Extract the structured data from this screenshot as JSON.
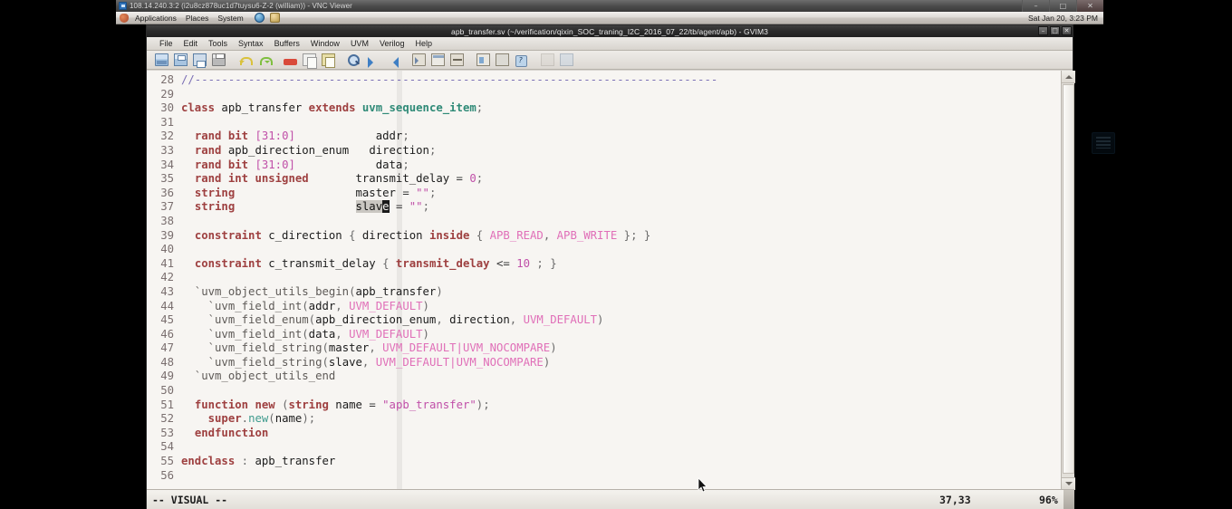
{
  "vnc": {
    "title": "108.14.240.3:2 (i2u8cz878uc1d7tuysu6-Z-2 (william)) - VNC Viewer",
    "icon": "vnc-icon",
    "buttons": [
      {
        "name": "minimize",
        "glyph": "–"
      },
      {
        "name": "maximize",
        "glyph": "□"
      },
      {
        "name": "close",
        "glyph": "✕"
      }
    ]
  },
  "gnome_panel": {
    "menus": [
      "Applications",
      "Places",
      "System"
    ],
    "launchers": [
      "web-browser-icon",
      "mail-client-icon"
    ],
    "clock": "Sat Jan 20,  3:23 PM"
  },
  "gvim": {
    "title": "apb_transfer.sv (~/verification/qixin_SOC_traning_I2C_2016_07_22/tb/agent/apb) - GVIM3",
    "window_buttons": [
      {
        "name": "minimize",
        "glyph": "–"
      },
      {
        "name": "maximize",
        "glyph": "□"
      },
      {
        "name": "close",
        "glyph": "✕"
      }
    ],
    "menubar": [
      "File",
      "Edit",
      "Tools",
      "Syntax",
      "Buffers",
      "Window",
      "UVM",
      "Verilog",
      "Help"
    ],
    "toolbar": [
      "open-icon",
      "save-all-icon",
      "save-icon",
      "print-icon",
      "sep",
      "undo-icon",
      "redo-icon",
      "sep",
      "cut-icon",
      "copy-icon",
      "paste-icon",
      "sep",
      "find-icon",
      "find-next-icon",
      "find-prev-icon",
      "sep",
      "tag-jump-icon",
      "split-window-icon",
      "make-icon",
      "sep",
      "shell-icon",
      "stop-icon",
      "help-icon",
      "sep",
      "load-session-icon",
      "save-session-icon"
    ],
    "status": {
      "mode": "-- VISUAL --",
      "ruler": "37,33",
      "percent": "96%"
    },
    "scrollbar": {
      "position": "bottom"
    }
  },
  "code": {
    "first_line": 28,
    "lines": [
      {
        "n": 28,
        "tokens": [
          {
            "t": "//------------------------------------------------------------------------------",
            "c": "comment"
          }
        ]
      },
      {
        "n": 29,
        "tokens": []
      },
      {
        "n": 30,
        "tokens": [
          {
            "t": "class ",
            "c": "kw"
          },
          {
            "t": "apb_transfer ",
            "c": "ident"
          },
          {
            "t": "extends ",
            "c": "kw"
          },
          {
            "t": "uvm_sequence_item",
            "c": "type"
          },
          {
            "t": ";",
            "c": "punct"
          }
        ]
      },
      {
        "n": 31,
        "tokens": []
      },
      {
        "n": 32,
        "tokens": [
          {
            "t": "  ",
            "c": "ident"
          },
          {
            "t": "rand bit ",
            "c": "kw"
          },
          {
            "t": "[31:0]",
            "c": "range"
          },
          {
            "t": "            addr",
            "c": "ident"
          },
          {
            "t": ";",
            "c": "punct"
          }
        ]
      },
      {
        "n": 33,
        "tokens": [
          {
            "t": "  ",
            "c": "ident"
          },
          {
            "t": "rand ",
            "c": "kw"
          },
          {
            "t": "apb_direction_enum",
            "c": "ident"
          },
          {
            "t": "   direction",
            "c": "ident"
          },
          {
            "t": ";",
            "c": "punct"
          }
        ]
      },
      {
        "n": 34,
        "tokens": [
          {
            "t": "  ",
            "c": "ident"
          },
          {
            "t": "rand bit ",
            "c": "kw"
          },
          {
            "t": "[31:0]",
            "c": "range"
          },
          {
            "t": "            data",
            "c": "ident"
          },
          {
            "t": ";",
            "c": "punct"
          }
        ]
      },
      {
        "n": 35,
        "tokens": [
          {
            "t": "  ",
            "c": "ident"
          },
          {
            "t": "rand int unsigned",
            "c": "kw"
          },
          {
            "t": "       transmit_delay ",
            "c": "ident"
          },
          {
            "t": "= ",
            "c": "op"
          },
          {
            "t": "0",
            "c": "num"
          },
          {
            "t": ";",
            "c": "punct"
          }
        ]
      },
      {
        "n": 36,
        "tokens": [
          {
            "t": "  ",
            "c": "ident"
          },
          {
            "t": "string",
            "c": "kw"
          },
          {
            "t": "                  master ",
            "c": "ident"
          },
          {
            "t": "= ",
            "c": "op"
          },
          {
            "t": "\"\"",
            "c": "str"
          },
          {
            "t": ";",
            "c": "punct"
          }
        ]
      },
      {
        "n": 37,
        "tokens": [
          {
            "t": "  ",
            "c": "ident"
          },
          {
            "t": "string",
            "c": "kw"
          },
          {
            "t": "                  ",
            "c": "ident"
          },
          {
            "t": "slav",
            "c": "visual"
          },
          {
            "t": "e",
            "c": "cursor"
          },
          {
            "t": " ",
            "c": "ident"
          },
          {
            "t": "= ",
            "c": "op"
          },
          {
            "t": "\"\"",
            "c": "str"
          },
          {
            "t": ";",
            "c": "punct"
          }
        ]
      },
      {
        "n": 38,
        "tokens": []
      },
      {
        "n": 39,
        "tokens": [
          {
            "t": "  ",
            "c": "ident"
          },
          {
            "t": "constraint ",
            "c": "kw"
          },
          {
            "t": "c_direction ",
            "c": "ident"
          },
          {
            "t": "{ ",
            "c": "punct"
          },
          {
            "t": "direction ",
            "c": "ident"
          },
          {
            "t": "inside ",
            "c": "kw"
          },
          {
            "t": "{ ",
            "c": "punct"
          },
          {
            "t": "APB_READ",
            "c": "const"
          },
          {
            "t": ", ",
            "c": "punct"
          },
          {
            "t": "APB_WRITE",
            "c": "const"
          },
          {
            "t": " }; }",
            "c": "punct"
          }
        ]
      },
      {
        "n": 40,
        "tokens": []
      },
      {
        "n": 41,
        "tokens": [
          {
            "t": "  ",
            "c": "ident"
          },
          {
            "t": "constraint ",
            "c": "kw"
          },
          {
            "t": "c_transmit_delay ",
            "c": "ident"
          },
          {
            "t": "{ ",
            "c": "punct"
          },
          {
            "t": "transmit_delay ",
            "c": "kw"
          },
          {
            "t": "<= ",
            "c": "op"
          },
          {
            "t": "10",
            "c": "num"
          },
          {
            "t": " ; }",
            "c": "punct"
          }
        ]
      },
      {
        "n": 42,
        "tokens": []
      },
      {
        "n": 43,
        "tokens": [
          {
            "t": "  `uvm_object_utils_begin",
            "c": "macro"
          },
          {
            "t": "(",
            "c": "punct"
          },
          {
            "t": "apb_transfer",
            "c": "ident"
          },
          {
            "t": ")",
            "c": "punct"
          }
        ]
      },
      {
        "n": 44,
        "tokens": [
          {
            "t": "    `uvm_field_int",
            "c": "macro"
          },
          {
            "t": "(",
            "c": "punct"
          },
          {
            "t": "addr",
            "c": "ident"
          },
          {
            "t": ", ",
            "c": "punct"
          },
          {
            "t": "UVM_DEFAULT",
            "c": "const"
          },
          {
            "t": ")",
            "c": "punct"
          }
        ]
      },
      {
        "n": 45,
        "tokens": [
          {
            "t": "    `uvm_field_enum",
            "c": "macro"
          },
          {
            "t": "(",
            "c": "punct"
          },
          {
            "t": "apb_direction_enum",
            "c": "ident"
          },
          {
            "t": ", ",
            "c": "punct"
          },
          {
            "t": "direction",
            "c": "ident"
          },
          {
            "t": ", ",
            "c": "punct"
          },
          {
            "t": "UVM_DEFAULT",
            "c": "const"
          },
          {
            "t": ")",
            "c": "punct"
          }
        ]
      },
      {
        "n": 46,
        "tokens": [
          {
            "t": "    `uvm_field_int",
            "c": "macro"
          },
          {
            "t": "(",
            "c": "punct"
          },
          {
            "t": "data",
            "c": "ident"
          },
          {
            "t": ", ",
            "c": "punct"
          },
          {
            "t": "UVM_DEFAULT",
            "c": "const"
          },
          {
            "t": ")",
            "c": "punct"
          }
        ]
      },
      {
        "n": 47,
        "tokens": [
          {
            "t": "    `uvm_field_string",
            "c": "macro"
          },
          {
            "t": "(",
            "c": "punct"
          },
          {
            "t": "master",
            "c": "ident"
          },
          {
            "t": ", ",
            "c": "punct"
          },
          {
            "t": "UVM_DEFAULT|UVM_NOCOMPARE",
            "c": "const"
          },
          {
            "t": ")",
            "c": "punct"
          }
        ]
      },
      {
        "n": 48,
        "tokens": [
          {
            "t": "    `uvm_field_string",
            "c": "macro"
          },
          {
            "t": "(",
            "c": "punct"
          },
          {
            "t": "slave",
            "c": "ident"
          },
          {
            "t": ", ",
            "c": "punct"
          },
          {
            "t": "UVM_DEFAULT|UVM_NOCOMPARE",
            "c": "const"
          },
          {
            "t": ")",
            "c": "punct"
          }
        ]
      },
      {
        "n": 49,
        "tokens": [
          {
            "t": "  `uvm_object_utils_end",
            "c": "macro"
          }
        ]
      },
      {
        "n": 50,
        "tokens": []
      },
      {
        "n": 51,
        "tokens": [
          {
            "t": "  ",
            "c": "ident"
          },
          {
            "t": "function new ",
            "c": "kw"
          },
          {
            "t": "(",
            "c": "punct"
          },
          {
            "t": "string ",
            "c": "kw"
          },
          {
            "t": "name ",
            "c": "ident"
          },
          {
            "t": "= ",
            "c": "op"
          },
          {
            "t": "\"apb_transfer\"",
            "c": "str"
          },
          {
            "t": ");",
            "c": "punct"
          }
        ]
      },
      {
        "n": 52,
        "tokens": [
          {
            "t": "    ",
            "c": "ident"
          },
          {
            "t": "super",
            "c": "kw"
          },
          {
            "t": ".",
            "c": "punct"
          },
          {
            "t": "new",
            "c": "meth"
          },
          {
            "t": "(",
            "c": "punct"
          },
          {
            "t": "name",
            "c": "ident"
          },
          {
            "t": ");",
            "c": "punct"
          }
        ]
      },
      {
        "n": 53,
        "tokens": [
          {
            "t": "  ",
            "c": "ident"
          },
          {
            "t": "endfunction",
            "c": "kw"
          }
        ]
      },
      {
        "n": 54,
        "tokens": []
      },
      {
        "n": 55,
        "tokens": [
          {
            "t": "endclass ",
            "c": "kw"
          },
          {
            "t": ": ",
            "c": "punct"
          },
          {
            "t": "apb_transfer",
            "c": "ident"
          }
        ]
      },
      {
        "n": 56,
        "tokens": []
      }
    ]
  },
  "desktop": {
    "icons": [
      "computer-icon"
    ]
  },
  "colors": {
    "keyword": "#9e4040",
    "type": "#2f8a77",
    "string": "#c04fa8",
    "constant": "#e06fb8",
    "comment": "#7b6fb5",
    "macro": "#5e5a57",
    "editor_bg": "#f7f5f2",
    "visual_selection": "#cac7c2",
    "cursor": "#1a1a1a"
  }
}
